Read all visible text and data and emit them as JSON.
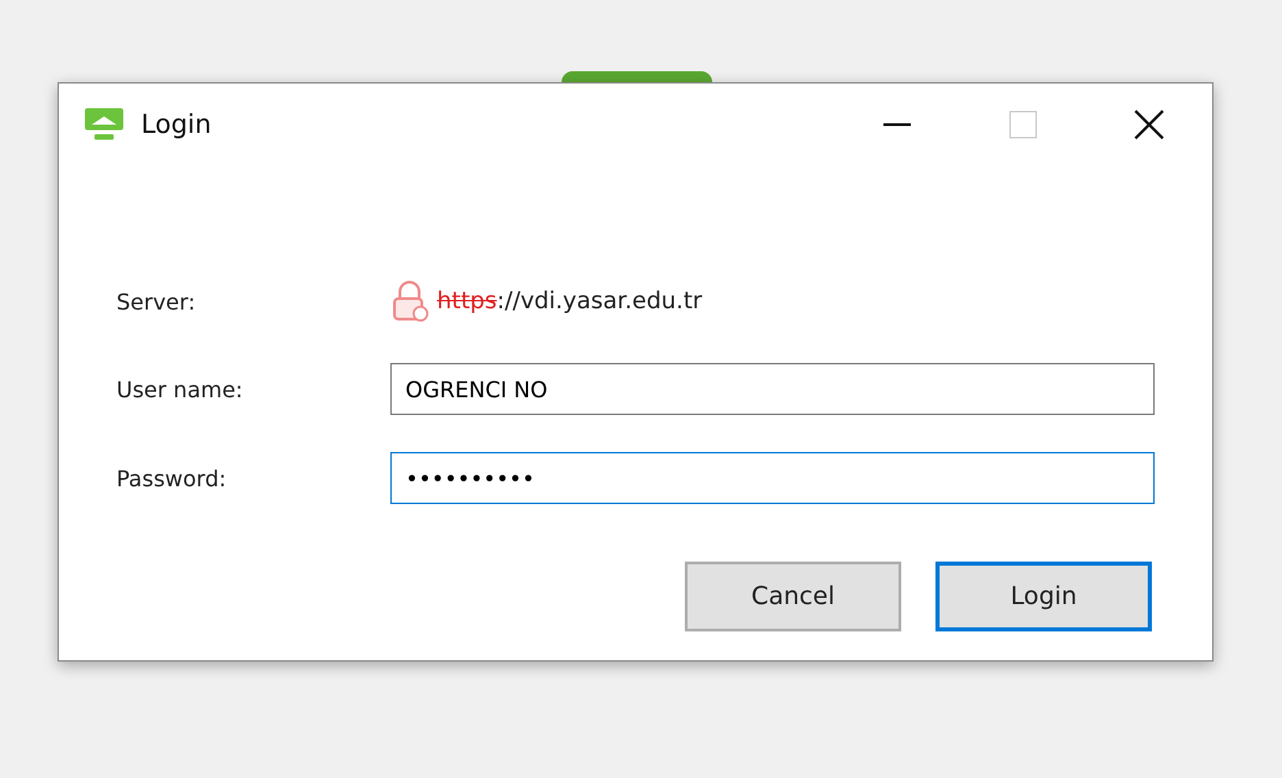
{
  "window": {
    "title": "Login",
    "controls": [
      {
        "kind": "minimize",
        "disabled": false
      },
      {
        "kind": "maximize",
        "disabled": true
      },
      {
        "kind": "close",
        "disabled": false
      }
    ]
  },
  "server": {
    "label": "Server:",
    "insecure": true,
    "scheme": "https",
    "rest": "://vdi.yasar.edu.tr"
  },
  "fields": [
    {
      "label": "User name:",
      "value": "OGRENCI NO",
      "focused": false
    },
    {
      "label": "Password:",
      "value": "••••••••••",
      "focused": true
    }
  ],
  "buttons": [
    {
      "label": "Cancel",
      "default": false
    },
    {
      "label": "Login",
      "default": true
    }
  ]
}
